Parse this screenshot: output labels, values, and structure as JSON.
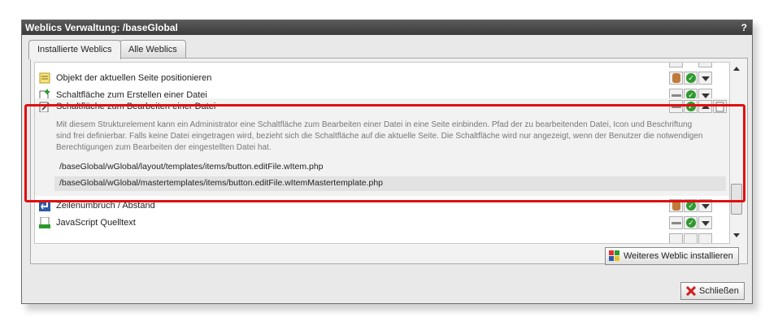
{
  "window": {
    "title": "Weblics Verwaltung: /baseGlobal",
    "help": "?"
  },
  "tabs": [
    {
      "label": "Installierte Weblics"
    },
    {
      "label": "Alle Weblics"
    }
  ],
  "rows": [
    {
      "label": "Objekt der aktuellen Seite positionieren",
      "icon": "note-icon"
    },
    {
      "label": "Schaltfläche zum Erstellen einer Datei",
      "icon": "new-file-icon"
    },
    {
      "label": "Schaltfläche zum Bearbeiten einer Datei",
      "icon": "edit-file-icon"
    },
    {
      "label": "Zeilenumbruch / Abstand",
      "icon": "linebreak-icon"
    },
    {
      "label": "JavaScript Quelltext",
      "icon": "javascript-icon"
    }
  ],
  "expanded": {
    "description": "Mit diesem Strukturelement kann ein Administrator eine Schaltfläche zum Bearbeiten einer Datei in eine Seite einbinden. Pfad der zu bearbeitenden Datei, Icon und Beschriftung sind frei definierbar. Falls keine Datei eingetragen wird, bezieht sich die Schaltfläche auf die aktuelle Seite. Die Schaltfläche wird nur angezeigt, wenn der Benutzer die notwendigen Berechtigungen zum Bearbeiten der eingestellten Datei hat.",
    "paths": [
      "/baseGlobal/wGlobal/layout/templates/items/button.editFile.wItem.php",
      "/baseGlobal/wGlobal/mastertemplates/items/button.editFile.wItemMastertemplate.php"
    ]
  },
  "buttons": {
    "install": "Weiteres Weblic installieren",
    "close": "Schließen"
  },
  "colors": {
    "highlight": "#e01010",
    "ok": "#2f9a2f"
  }
}
